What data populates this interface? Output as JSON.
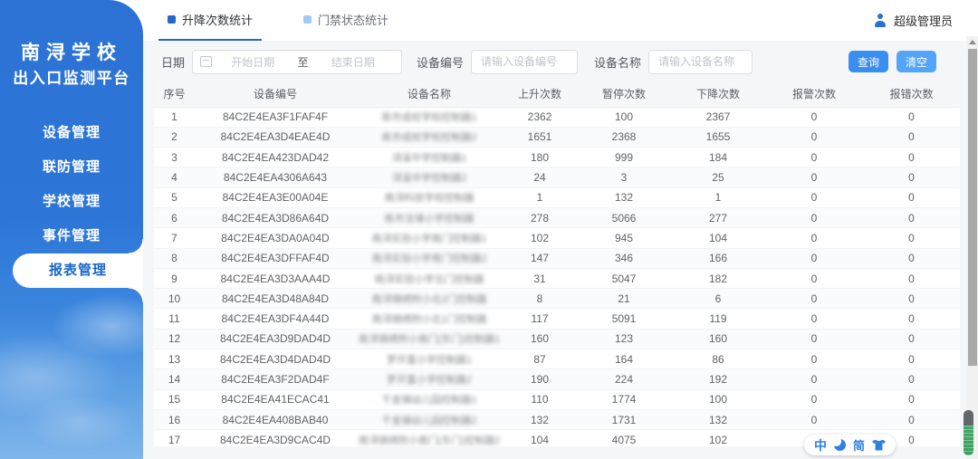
{
  "sidebar": {
    "title_line1": "南浔学校",
    "title_line2": "出入口监测平台",
    "items": [
      {
        "label": "设备管理",
        "active": false
      },
      {
        "label": "联防管理",
        "active": false
      },
      {
        "label": "学校管理",
        "active": false
      },
      {
        "label": "事件管理",
        "active": false
      },
      {
        "label": "报表管理",
        "active": true
      }
    ]
  },
  "header": {
    "tabs": [
      {
        "label": "升降次数统计",
        "active": true
      },
      {
        "label": "门禁状态统计",
        "active": false
      }
    ],
    "user": "超级管理员"
  },
  "filters": {
    "date_label": "日期",
    "start_placeholder": "开始日期",
    "range_separator": "至",
    "end_placeholder": "结束日期",
    "device_code_label": "设备编号",
    "device_code_placeholder": "请输入设备编号",
    "device_name_label": "设备名称",
    "device_name_placeholder": "请输入设备名称",
    "search_button": "查询",
    "clear_button": "清空"
  },
  "table": {
    "columns": [
      "序号",
      "设备编号",
      "设备名称",
      "上升次数",
      "暂停次数",
      "下降次数",
      "报警次数",
      "报错次数"
    ],
    "rows": [
      [
        1,
        "84C2E4EA3F1FAF4F",
        "练市成校学校控制器1",
        2362,
        100,
        2367,
        0,
        0
      ],
      [
        2,
        "84C2E4EA3D4EAE4D",
        "练市成校学校控制器2",
        1651,
        2368,
        1655,
        0,
        0
      ],
      [
        3,
        "84C2E4EA423DAD42",
        "浔溪中学控制器1",
        180,
        999,
        184,
        0,
        0
      ],
      [
        4,
        "84C2E4EA4306A643",
        "浔溪中学控制器2",
        24,
        3,
        25,
        0,
        0
      ],
      [
        5,
        "84C2E4EA3E00A04E",
        "南浔科技学校控制器",
        1,
        132,
        1,
        0,
        0
      ],
      [
        6,
        "84C2E4EA3D86A64D",
        "练市沈埭小学控制器",
        278,
        5066,
        277,
        0,
        0
      ],
      [
        7,
        "84C2E4EA3DA0A04D",
        "南浔实验小学南门控制器1",
        102,
        945,
        104,
        0,
        0
      ],
      [
        8,
        "84C2E4EA3DFFAF4D",
        "南浔实验小学南门控制器2",
        147,
        346,
        166,
        0,
        0
      ],
      [
        9,
        "84C2E4EA3D3AAA4D",
        "南浔实验小学北门控制器",
        31,
        5047,
        182,
        0,
        0
      ],
      [
        10,
        "84C2E4EA3D48A84D",
        "南浔锦绣附小北2门控制器",
        8,
        21,
        6,
        0,
        0
      ],
      [
        11,
        "84C2E4EA3DF4A44D",
        "南浔锦绣附小北1门控制器",
        117,
        5091,
        119,
        0,
        0
      ],
      [
        12,
        "84C2E4EA3D9DAD4D",
        "南浔锦绣附小南门(东门)控制器1",
        160,
        123,
        160,
        0,
        0
      ],
      [
        13,
        "84C2E4EA3D4DAD4D",
        "罗开富小学控制器1",
        87,
        164,
        86,
        0,
        0
      ],
      [
        14,
        "84C2E4EA3F2DAD4F",
        "罗开富小学控制器2",
        190,
        224,
        192,
        0,
        0
      ],
      [
        15,
        "84C2E4EA41ECAC41",
        "千金镇幼儿园控制器1",
        110,
        1774,
        100,
        0,
        0
      ],
      [
        16,
        "84C2E4EA408BAB40",
        "千金镇幼儿园控制器2",
        132,
        1731,
        132,
        0,
        0
      ],
      [
        17,
        "84C2E4EA3D9CAC4D",
        "南浔锦绣附小南门(东门)控制器2",
        104,
        4075,
        102,
        0,
        0
      ]
    ]
  },
  "ime_toolbar": {
    "lang_mode": "中",
    "simplified": "简"
  },
  "colors": {
    "sidebar_blue": "#2b72d4",
    "accent_blue": "#2566c9",
    "button_primary": "#3a8ef0",
    "button_plain": "#54a4f8"
  }
}
